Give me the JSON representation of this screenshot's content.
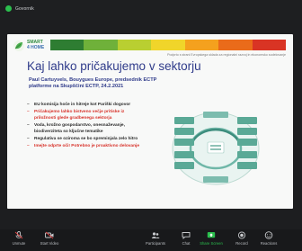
{
  "speaker": {
    "name": "Govornik"
  },
  "slide": {
    "logo": {
      "line1": "SMART",
      "line2": "4 HOME"
    },
    "tagline": "Podprto s strani Evropskega sklada za regionalni razvoj in ekonomsko sodelovanje",
    "title": "Kaj lahko pričakujemo v sektorju",
    "subtitle": "Paul Cartuyvels, Bouygues Europe, predsednik ECTP platforme na Skupščini ECTP, 24.2.2021",
    "bullets": [
      {
        "text": "EU komisija hoče in hitreje kot Pariški dogovor",
        "tone": "dark"
      },
      {
        "text": "Pričakujemo lahko bistveno večje pritiske iz priložnosti glede gradbenega sektorja",
        "tone": "red"
      },
      {
        "text": "Voda, krožno gospodarstvo, onesnaževanje, biodiverziteta so ključne tematike",
        "tone": "dark"
      },
      {
        "text": "Regulativa se oziroma se bo spreminjala zelo hitro",
        "tone": "dark"
      },
      {
        "text": "Imejte odprte oči! Potrebno je proaktivno delovanje",
        "tone": "red"
      }
    ],
    "bar_colors": [
      "#2e7d32",
      "#6fb13a",
      "#b9cf31",
      "#f0d52a",
      "#f4a11e",
      "#ea6b1a",
      "#d93424"
    ]
  },
  "toolbar": {
    "buttons": [
      {
        "label": "Unmute",
        "icon": "microphone-icon"
      },
      {
        "label": "Start Video",
        "icon": "video-camera-icon"
      },
      {
        "label": "Participants",
        "icon": "participants-icon"
      },
      {
        "label": "Chat",
        "icon": "chat-icon"
      },
      {
        "label": "Share Screen",
        "icon": "share-screen-icon",
        "color": "#2bbf4e"
      },
      {
        "label": "Record",
        "icon": "record-icon"
      },
      {
        "label": "Reactions",
        "icon": "reactions-icon"
      }
    ]
  }
}
